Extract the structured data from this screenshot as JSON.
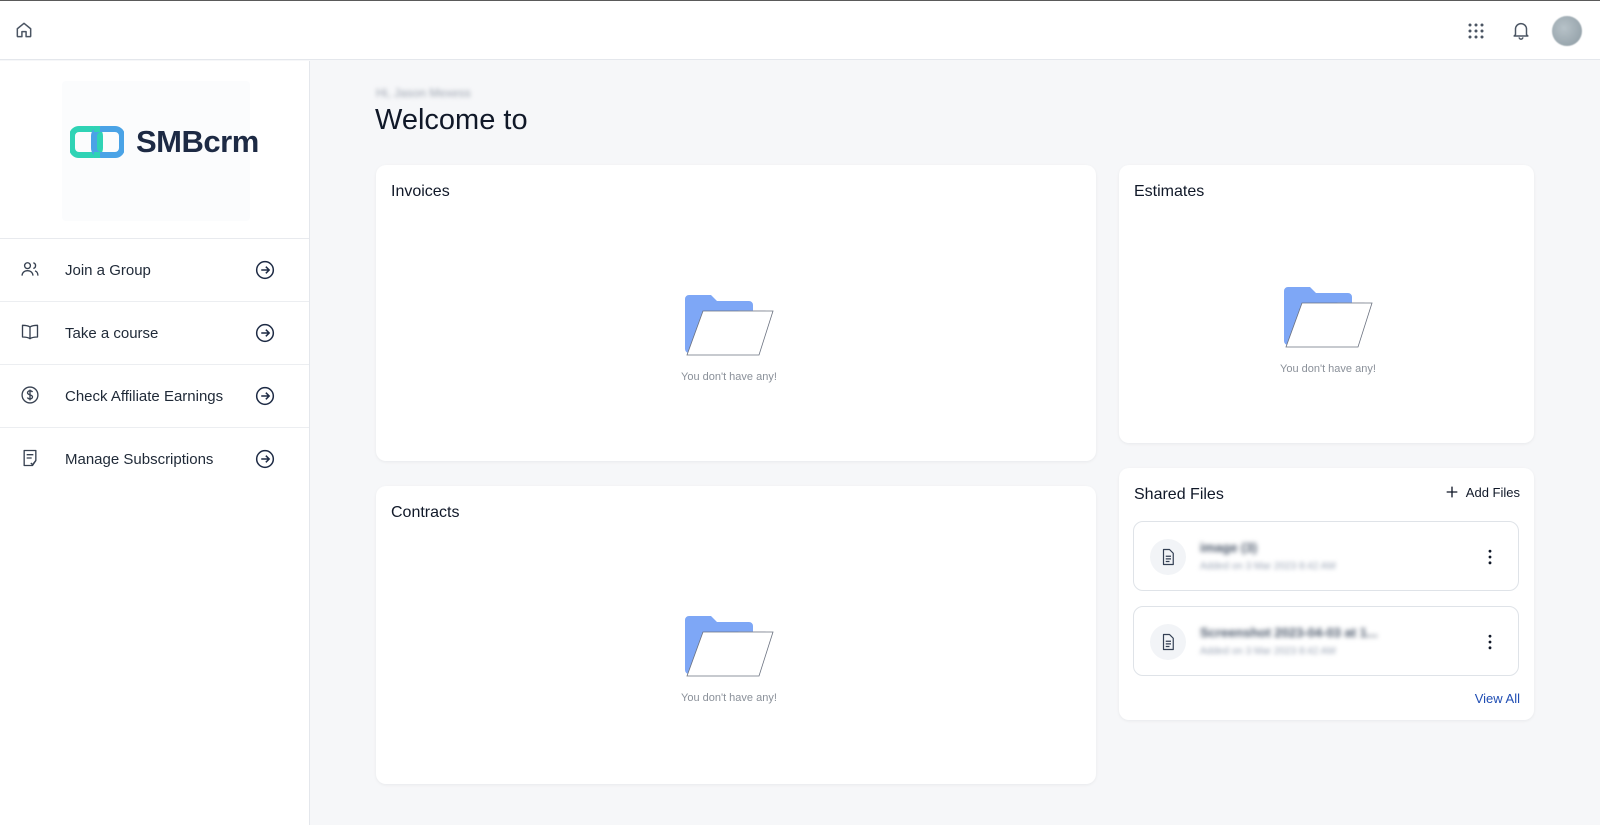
{
  "topbar": {
    "icons": [
      "home-icon",
      "apps-grid-icon",
      "bell-icon",
      "user-avatar"
    ]
  },
  "sidebar": {
    "logo_text": "SMBcrm",
    "items": [
      {
        "label": "Join a Group",
        "icon": "users-icon"
      },
      {
        "label": "Take a course",
        "icon": "book-icon"
      },
      {
        "label": "Check Affiliate Earnings",
        "icon": "dollar-icon"
      },
      {
        "label": "Manage Subscriptions",
        "icon": "subscription-icon"
      }
    ]
  },
  "main": {
    "breadcrumb": "Hi, Jason Mexess",
    "title": "Welcome to",
    "invoices": {
      "title": "Invoices",
      "empty_text": "You don't have any!"
    },
    "contracts": {
      "title": "Contracts",
      "empty_text": "You don't have any!"
    },
    "estimates": {
      "title": "Estimates",
      "empty_text": "You don't have any!"
    },
    "shared_files": {
      "title": "Shared Files",
      "add_label": "Add Files",
      "files": [
        {
          "name": "image (3)",
          "meta": "Added on 3 Mar 2023 8:42 AM"
        },
        {
          "name": "Screenshot 2023-04-03 at 1...",
          "meta": "Added on 3 Mar 2023 8:42 AM"
        }
      ],
      "view_all": "View All"
    }
  },
  "colors": {
    "folder_blue": "#7ea7f6",
    "link_blue": "#1f4db3",
    "logo_teal": "#2fd3b5",
    "logo_navy": "#1d2a44"
  }
}
